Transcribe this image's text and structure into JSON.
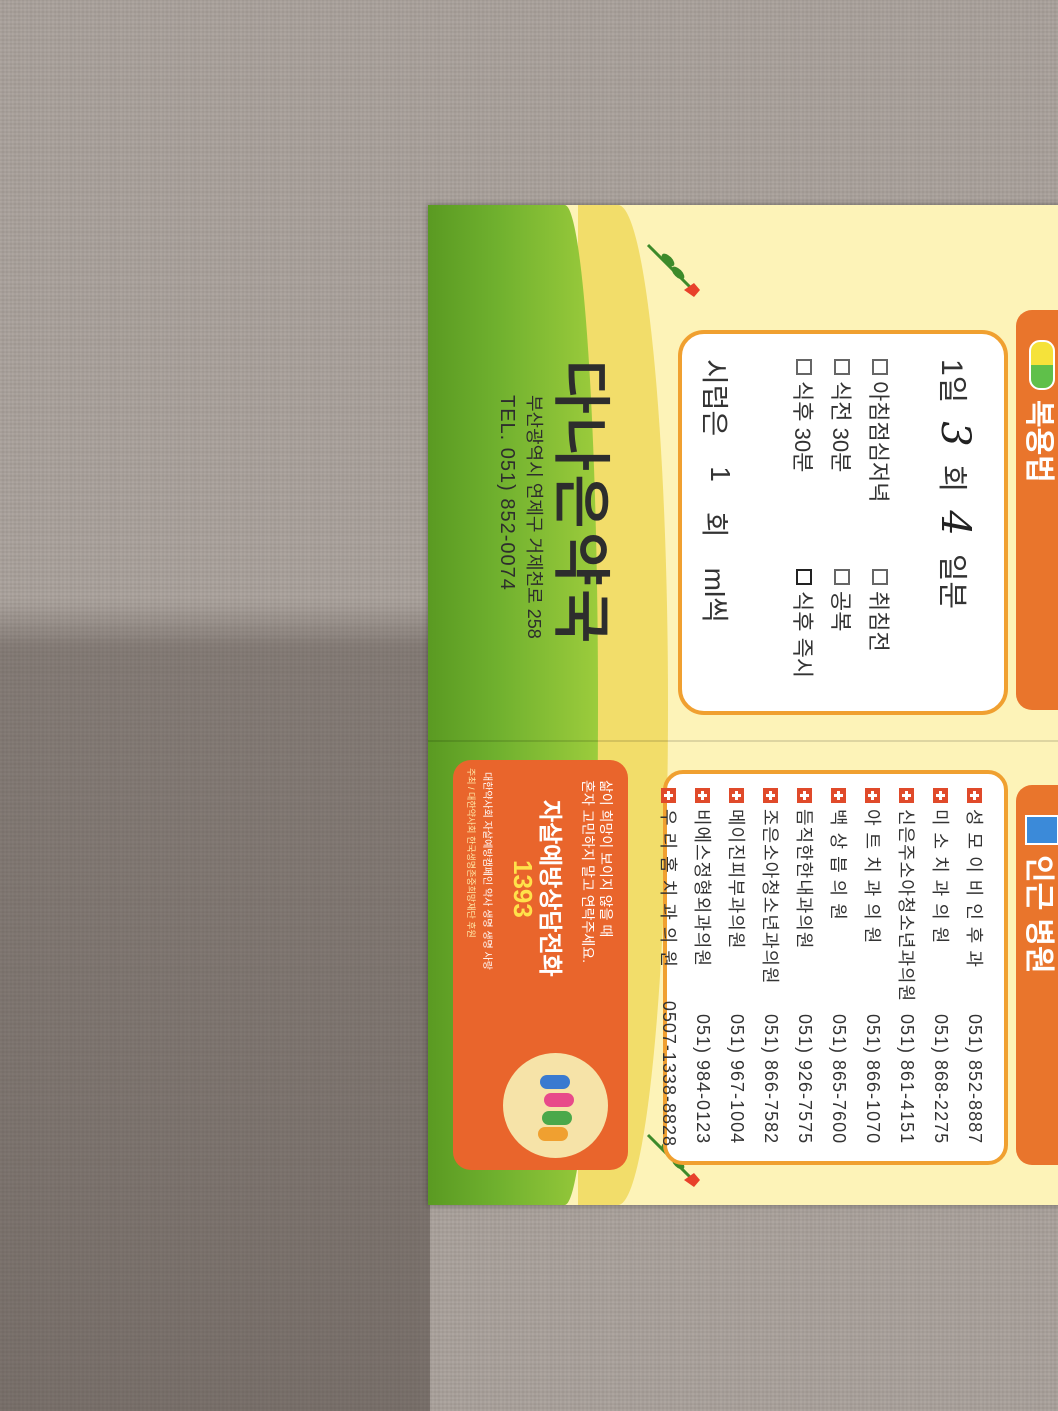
{
  "dosage": {
    "header": "복용법",
    "times_label": "1일",
    "times_value": "3",
    "times_unit": "회",
    "days_value": "4",
    "days_unit": "일분",
    "options_row1": [
      "아침점심저녁",
      "취침전"
    ],
    "options_row2": [
      "식전 30분",
      "공복"
    ],
    "options_row3": [
      "식후 30분",
      "식후 즉시"
    ],
    "syrup": [
      "시럽은",
      "1",
      "회",
      "ml씩"
    ]
  },
  "hospitals": {
    "header": "인근 병원",
    "list": [
      {
        "name": "성 모 이 비 인 후 과",
        "tel": "051) 852-8887"
      },
      {
        "name": "미 소 치 과 의 원",
        "tel": "051) 868-2275"
      },
      {
        "name": "신은주소아청소년과의원",
        "tel": "051) 861-4151"
      },
      {
        "name": "아 트 치 과 의 원",
        "tel": "051) 866-1070"
      },
      {
        "name": "백  상  븝  의  원",
        "tel": "051) 865-7600"
      },
      {
        "name": "듬직한한내과의원",
        "tel": "051) 926-7575"
      },
      {
        "name": "조은소아청소년과의원",
        "tel": "051) 866-7582"
      },
      {
        "name": "메이진피부과의원",
        "tel": "051) 967-1004"
      },
      {
        "name": "비에스정형외과의원",
        "tel": "051) 984-0123"
      },
      {
        "name": "우 리 홈 치 과 의 원",
        "tel": "0507-1338-8828"
      }
    ]
  },
  "pharmacy": {
    "name": "다나은약국",
    "address": "부산광역시 연제구 거제천로 258",
    "tel": "TEL. 051) 852-0074"
  },
  "banner": {
    "line1": "삶이 희망이 보이지 않을 때",
    "line2": "혼자 고민하지 말고 연락주세요.",
    "title": "자살예방상담전화",
    "number": "1393",
    "org": "대한약사회 자살예방캠페인 약사 생명 생명 사랑",
    "footer": "주최 / 대한약사회 한국생명존중희망재단 후원"
  },
  "colors": {
    "orange": "#e9752c",
    "green": "#6fb02e",
    "paper": "#fdf3b8"
  }
}
